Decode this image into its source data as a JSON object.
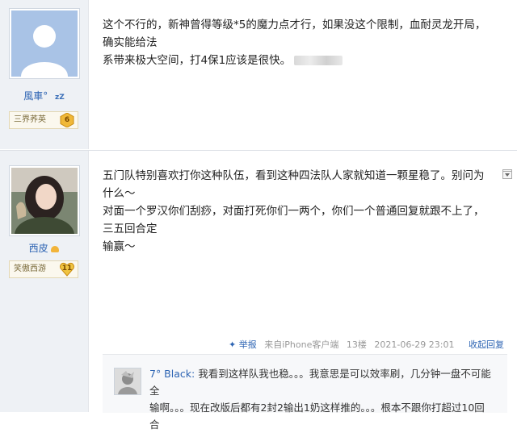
{
  "post1": {
    "username": "風車",
    "username_suffix": "°",
    "zzz": "zZ",
    "level_name": "三界荞英",
    "level_num": "6",
    "text_line1": "这个不行的，新神曾得等级*5的魔力点才行，如果没这个限制，血耐灵龙开局，确实能给法",
    "text_line2": "系带来极大空间，打4保1应该是很快。"
  },
  "post2": {
    "username": "西皮",
    "level_name": "笑傲西游",
    "level_num": "11",
    "text_line1": "五门队特别喜欢打你这种队伍，看到这种四法队人家就知道一颗星稳了。别问为什么～",
    "text_line2": "对面一个罗汉你们刮痧，对面打死你们一两个，你们一个普通回复就跟不上了，三五回合定",
    "text_line3": "输赢～",
    "meta": {
      "report": "举报",
      "source": "来自iPhone客户端",
      "floor": "13楼",
      "datetime": "2021-06-29 23:01",
      "reply": "收起回复"
    },
    "reply": {
      "user": "7° Black:",
      "line1": "我看到这样队我也稳。。。我意思是可以效率刷，几分钟一盘不可能全",
      "line2": "输啊。。。现在改版后都有2封2输出1奶这样推的。。。根本不跟你打超过10回",
      "line3": "合"
    }
  },
  "colors": {
    "link": "#2d64b3",
    "sidebar": "#eef1f5",
    "badge_gold": "#f0b838"
  }
}
